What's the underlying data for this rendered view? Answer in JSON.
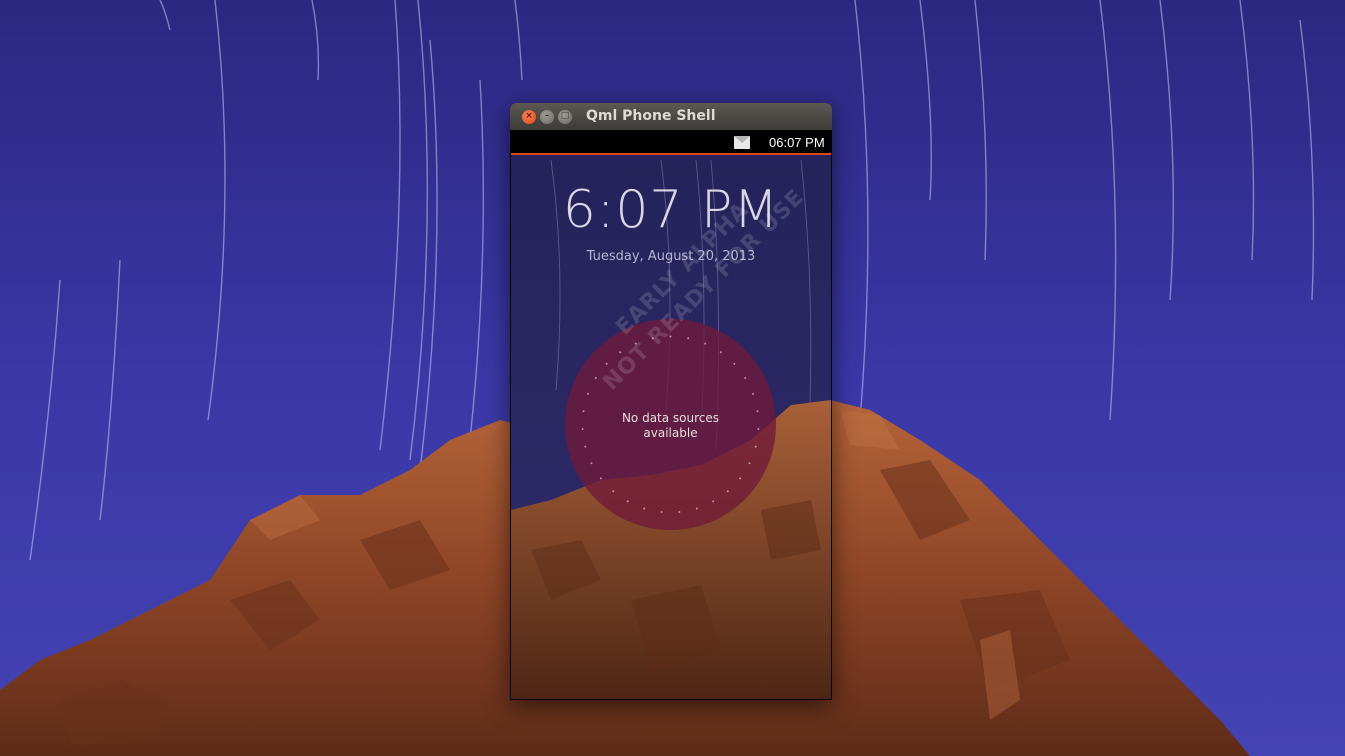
{
  "window": {
    "title": "Qml Phone Shell",
    "buttons": [
      "close",
      "minimize",
      "maximize"
    ]
  },
  "statusbar": {
    "icon": "envelope-icon",
    "time": "06:07 PM",
    "accent_color": "#dd4814"
  },
  "lockscreen": {
    "clock": "6:07 PM",
    "date": "Tuesday, August 20, 2013",
    "infographic_message_line1": "No data sources",
    "infographic_message_line2": "available",
    "watermark_line1": "EARLY ALPHA",
    "watermark_line2": "NOT READY FOR USE"
  },
  "colors": {
    "sky": "#3a36a0",
    "rock": "#9a4a28",
    "infographic": "#701a3a",
    "titlebar": "#3c3b37"
  }
}
